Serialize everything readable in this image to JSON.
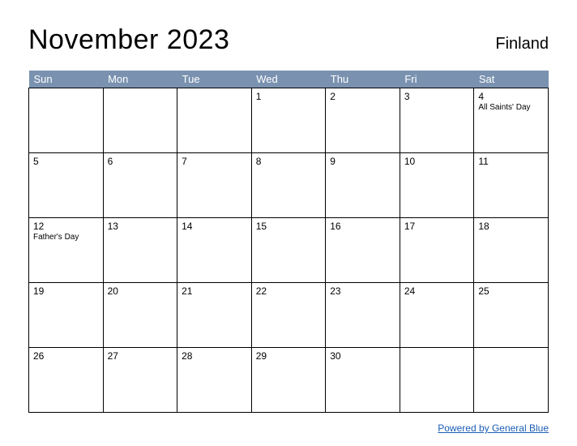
{
  "header": {
    "title": "November 2023",
    "region": "Finland"
  },
  "weekdays": [
    "Sun",
    "Mon",
    "Tue",
    "Wed",
    "Thu",
    "Fri",
    "Sat"
  ],
  "weeks": [
    [
      {
        "day": "",
        "event": ""
      },
      {
        "day": "",
        "event": ""
      },
      {
        "day": "",
        "event": ""
      },
      {
        "day": "1",
        "event": ""
      },
      {
        "day": "2",
        "event": ""
      },
      {
        "day": "3",
        "event": ""
      },
      {
        "day": "4",
        "event": "All Saints' Day"
      }
    ],
    [
      {
        "day": "5",
        "event": ""
      },
      {
        "day": "6",
        "event": ""
      },
      {
        "day": "7",
        "event": ""
      },
      {
        "day": "8",
        "event": ""
      },
      {
        "day": "9",
        "event": ""
      },
      {
        "day": "10",
        "event": ""
      },
      {
        "day": "11",
        "event": ""
      }
    ],
    [
      {
        "day": "12",
        "event": "Father's Day"
      },
      {
        "day": "13",
        "event": ""
      },
      {
        "day": "14",
        "event": ""
      },
      {
        "day": "15",
        "event": ""
      },
      {
        "day": "16",
        "event": ""
      },
      {
        "day": "17",
        "event": ""
      },
      {
        "day": "18",
        "event": ""
      }
    ],
    [
      {
        "day": "19",
        "event": ""
      },
      {
        "day": "20",
        "event": ""
      },
      {
        "day": "21",
        "event": ""
      },
      {
        "day": "22",
        "event": ""
      },
      {
        "day": "23",
        "event": ""
      },
      {
        "day": "24",
        "event": ""
      },
      {
        "day": "25",
        "event": ""
      }
    ],
    [
      {
        "day": "26",
        "event": ""
      },
      {
        "day": "27",
        "event": ""
      },
      {
        "day": "28",
        "event": ""
      },
      {
        "day": "29",
        "event": ""
      },
      {
        "day": "30",
        "event": ""
      },
      {
        "day": "",
        "event": ""
      },
      {
        "day": "",
        "event": ""
      }
    ]
  ],
  "footer": {
    "link_text": "Powered by General Blue"
  }
}
